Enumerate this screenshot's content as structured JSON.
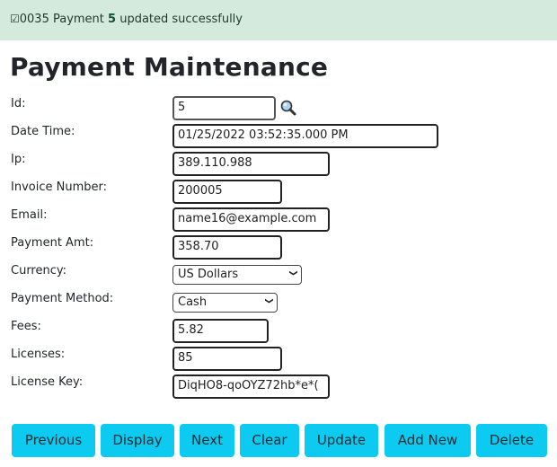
{
  "alert": {
    "icon": "checkbox-checked-icon",
    "icon_glyph": "☑",
    "prefix": "0035 Payment ",
    "id": "5",
    "suffix": " updated successfully",
    "background": "#d4eadd"
  },
  "page_title": "Payment Maintenance",
  "form": {
    "id": {
      "label": "Id:",
      "value": "5"
    },
    "date_time": {
      "label": "Date Time:",
      "value": "01/25/2022 03:52:35.000  PM"
    },
    "ip": {
      "label": "Ip:",
      "value": "389.110.988"
    },
    "invoice_number": {
      "label": "Invoice Number:",
      "value": "200005"
    },
    "email": {
      "label": "Email:",
      "value": "name16@example.com"
    },
    "payment_amt": {
      "label": "Payment Amt:",
      "value": "358.70"
    },
    "currency": {
      "label": "Currency:",
      "selected": "US Dollars"
    },
    "payment_method": {
      "label": "Payment Method:",
      "selected": "Cash"
    },
    "fees": {
      "label": "Fees:",
      "value": "5.82"
    },
    "licenses": {
      "label": "Licenses:",
      "value": "85"
    },
    "license_key": {
      "label": "License Key:",
      "value": "DiqHO8-qoOYZ72hb*e*("
    }
  },
  "search_icon": "magnifier-icon",
  "buttons": {
    "previous": "Previous",
    "display": "Display",
    "next": "Next",
    "clear": "Clear",
    "update": "Update",
    "add_new": "Add New",
    "delete": "Delete",
    "color": "#0dcaf0"
  }
}
